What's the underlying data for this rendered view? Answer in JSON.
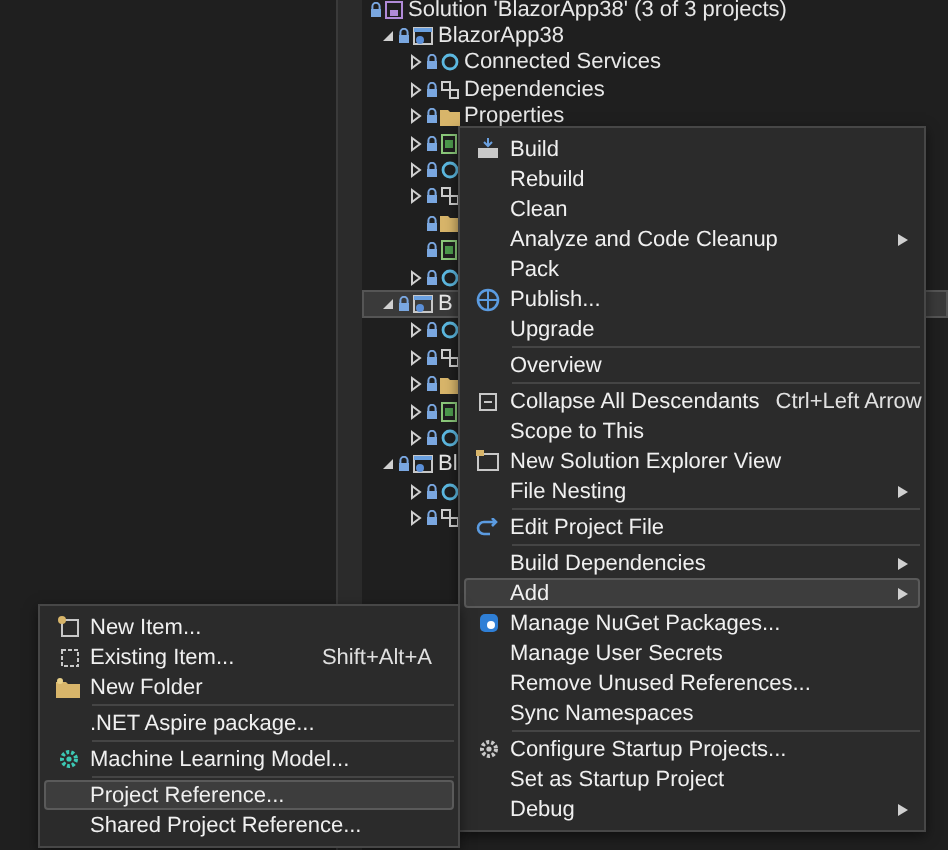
{
  "tree": [
    {
      "label": "Solution 'BlazorApp38' (3 of 3 projects)",
      "selected": false,
      "children": [
        {
          "label": "BlazorApp38",
          "expanded": true,
          "selected": false,
          "children": [
            {
              "label": "Connected Services",
              "expanded": false,
              "selected": false
            },
            {
              "label": "Dependencies",
              "expanded": false,
              "selected": false
            },
            {
              "label": "Properties",
              "expanded": false,
              "selected": false
            },
            {
              "expanded": false,
              "selected": false
            },
            {
              "expanded": false,
              "selected": false
            },
            {
              "expanded": false,
              "selected": false
            },
            {
              "selected": false
            },
            {
              "selected": false
            },
            {
              "expanded": false,
              "selected": false
            }
          ]
        },
        {
          "label": "B",
          "expanded": true,
          "selected": true,
          "children": [
            {
              "expanded": false,
              "selected": false
            },
            {
              "expanded": false,
              "selected": false
            },
            {
              "expanded": false,
              "selected": false
            },
            {
              "expanded": false,
              "selected": false
            },
            {
              "expanded": false,
              "selected": false
            }
          ]
        },
        {
          "label": "Bl",
          "expanded": true,
          "selected": false,
          "children": [
            {
              "expanded": false,
              "selected": false
            },
            {
              "expanded": false,
              "selected": false
            }
          ]
        }
      ]
    }
  ],
  "context_menu": [
    {
      "kind": "item",
      "label": "Build",
      "selected": false
    },
    {
      "kind": "item",
      "label": "Rebuild",
      "selected": false
    },
    {
      "kind": "item",
      "label": "Clean",
      "selected": false
    },
    {
      "kind": "item",
      "label": "Analyze and Code Cleanup",
      "submenu": true,
      "selected": false
    },
    {
      "kind": "item",
      "label": "Pack",
      "selected": false
    },
    {
      "kind": "item",
      "label": "Publish...",
      "selected": false
    },
    {
      "kind": "item",
      "label": "Upgrade",
      "selected": false
    },
    {
      "kind": "separator"
    },
    {
      "kind": "item",
      "label": "Overview",
      "selected": false
    },
    {
      "kind": "separator"
    },
    {
      "kind": "item",
      "label": "Collapse All Descendants",
      "shortcut": "Ctrl+Left Arrow",
      "selected": false
    },
    {
      "kind": "item",
      "label": "Scope to This",
      "selected": false
    },
    {
      "kind": "item",
      "label": "New Solution Explorer View",
      "selected": false
    },
    {
      "kind": "item",
      "label": "File Nesting",
      "submenu": true,
      "selected": false
    },
    {
      "kind": "separator"
    },
    {
      "kind": "item",
      "label": "Edit Project File",
      "selected": false
    },
    {
      "kind": "separator"
    },
    {
      "kind": "item",
      "label": "Build Dependencies",
      "submenu": true,
      "selected": false
    },
    {
      "kind": "item",
      "label": "Add",
      "submenu": true,
      "selected": true
    },
    {
      "kind": "item",
      "label": "Manage NuGet Packages...",
      "selected": false
    },
    {
      "kind": "item",
      "label": "Manage User Secrets",
      "selected": false
    },
    {
      "kind": "item",
      "label": "Remove Unused References...",
      "selected": false
    },
    {
      "kind": "item",
      "label": "Sync Namespaces",
      "selected": false
    },
    {
      "kind": "separator"
    },
    {
      "kind": "item",
      "label": "Configure Startup Projects...",
      "selected": false
    },
    {
      "kind": "item",
      "label": "Set as Startup Project",
      "selected": false
    },
    {
      "kind": "item",
      "label": "Debug",
      "submenu": true,
      "selected": false
    }
  ],
  "add_submenu": [
    {
      "kind": "item",
      "label": "New Item...",
      "selected": false
    },
    {
      "kind": "item",
      "label": "Existing Item...",
      "shortcut": "Shift+Alt+A",
      "selected": false
    },
    {
      "kind": "item",
      "label": "New Folder",
      "selected": false
    },
    {
      "kind": "separator"
    },
    {
      "kind": "item",
      "label": ".NET Aspire package...",
      "selected": false
    },
    {
      "kind": "separator"
    },
    {
      "kind": "item",
      "label": "Machine Learning Model...",
      "selected": false
    },
    {
      "kind": "separator"
    },
    {
      "kind": "item",
      "label": "Project Reference...",
      "selected": true
    },
    {
      "kind": "item",
      "label": "Shared Project Reference...",
      "selected": false
    }
  ]
}
